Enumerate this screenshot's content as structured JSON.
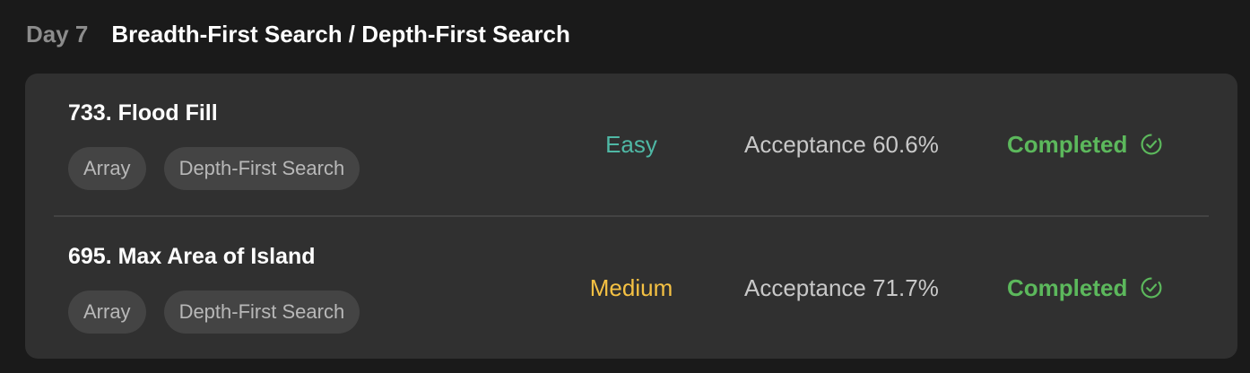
{
  "header": {
    "day": "Day 7",
    "title": "Breadth-First Search / Depth-First Search"
  },
  "problems": [
    {
      "title": "733. Flood Fill",
      "tags": [
        "Array",
        "Depth-First Search"
      ],
      "difficulty": "Easy",
      "acceptance": "Acceptance 60.6%",
      "status": "Completed"
    },
    {
      "title": "695. Max Area of Island",
      "tags": [
        "Array",
        "Depth-First Search"
      ],
      "difficulty": "Medium",
      "acceptance": "Acceptance 71.7%",
      "status": "Completed"
    }
  ],
  "colors": {
    "easy": "#4fb8a5",
    "medium": "#f5c143",
    "completed": "#5cb85c",
    "card_bg": "#303030",
    "page_bg": "#1a1a1a"
  },
  "icons": {
    "status": "check-circle-icon"
  }
}
